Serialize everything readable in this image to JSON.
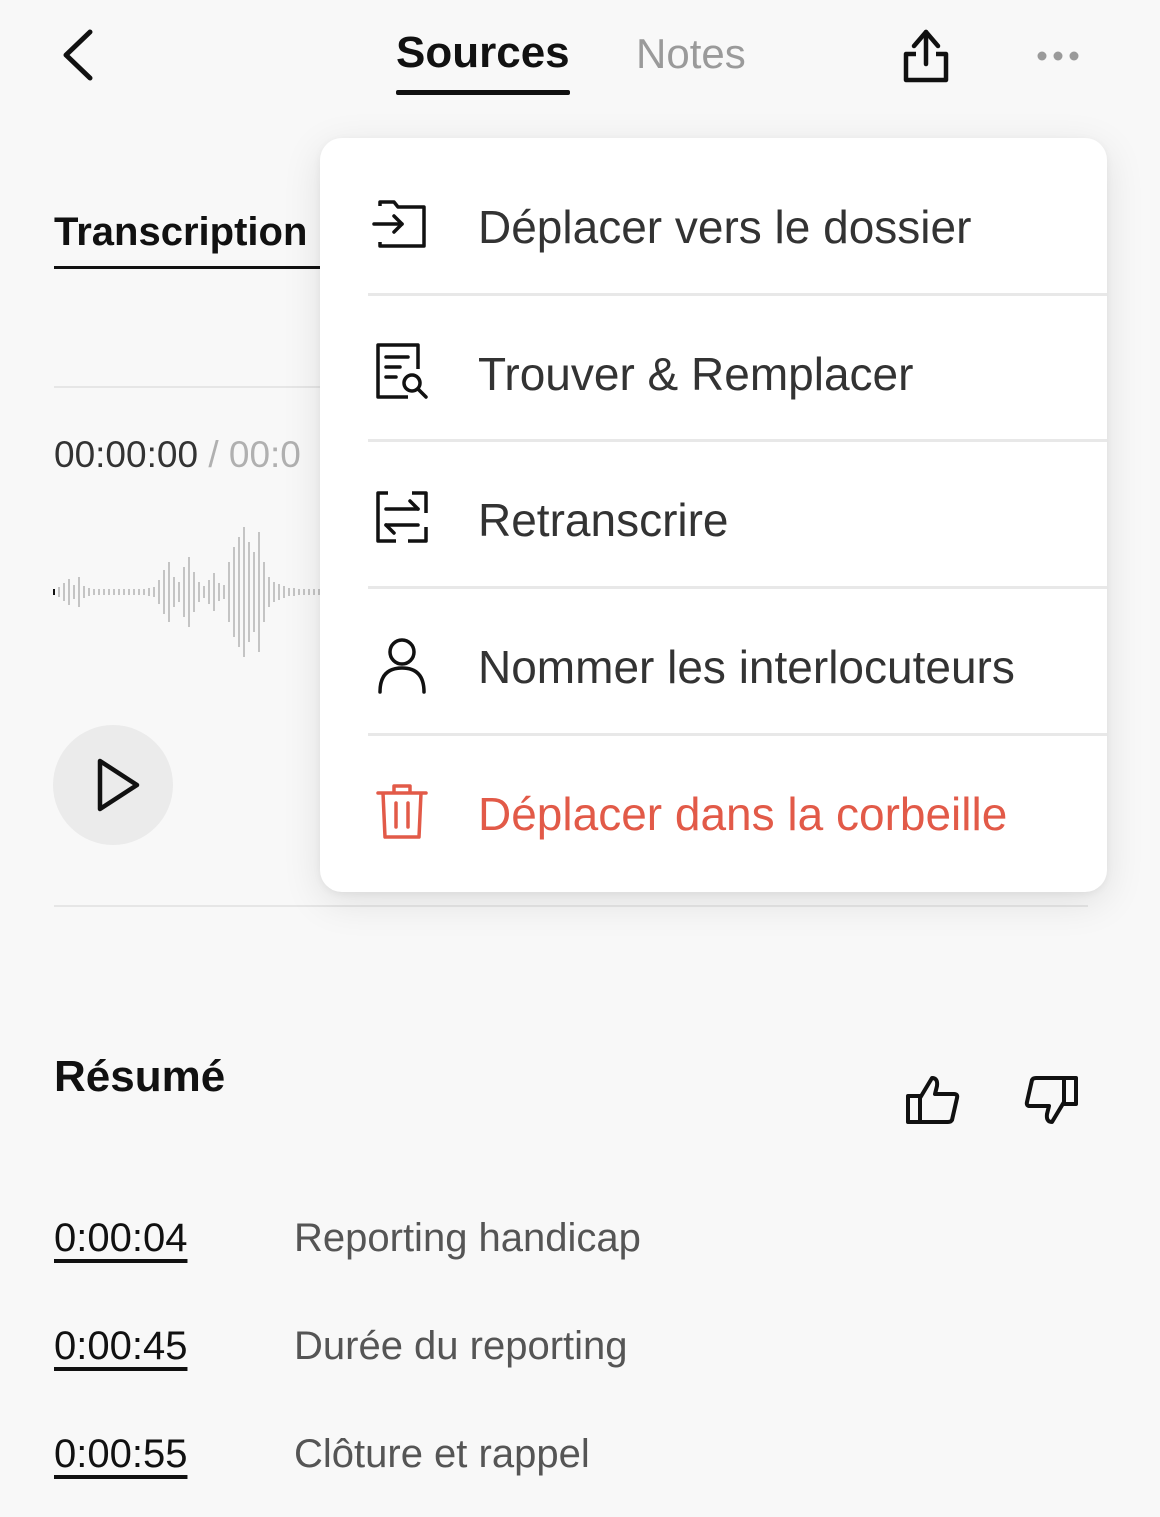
{
  "header": {
    "tabs": [
      {
        "label": "Sources",
        "active": true
      },
      {
        "label": "Notes",
        "active": false
      }
    ],
    "icons": [
      "chevron-left-icon",
      "share-icon",
      "more-horizontal-icon"
    ]
  },
  "transcription": {
    "tab_label": "Transcription",
    "time_current": "00:00:00",
    "time_separator": "/",
    "time_total_visible": "00:0"
  },
  "menu": {
    "items": [
      {
        "label": "Déplacer vers le dossier",
        "icon": "move-to-folder-icon",
        "danger": false
      },
      {
        "label": "Trouver & Remplacer",
        "icon": "find-replace-icon",
        "danger": false
      },
      {
        "label": "Retranscrire",
        "icon": "retranscribe-icon",
        "danger": false
      },
      {
        "label": "Nommer les interlocuteurs",
        "icon": "person-icon",
        "danger": false
      },
      {
        "label": "Déplacer dans la corbeille",
        "icon": "trash-icon",
        "danger": true
      }
    ]
  },
  "resume": {
    "title": "Résumé",
    "items": [
      {
        "time": "0:00:04",
        "text": "Reporting handicap"
      },
      {
        "time": "0:00:45",
        "text": "Durée du reporting"
      },
      {
        "time": "0:00:55",
        "text": "Clôture et rappel"
      }
    ]
  },
  "colors": {
    "background": "#f8f8f8",
    "danger": "#e25a48",
    "inactive_tab": "#9a9a9a"
  }
}
